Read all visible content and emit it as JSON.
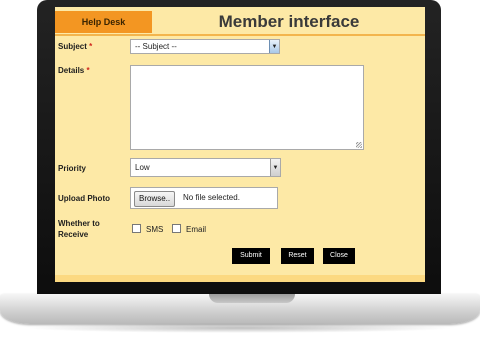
{
  "header": {
    "tab_label": "Help Desk",
    "title": "Member interface"
  },
  "form": {
    "subject": {
      "label": "Subject",
      "required_mark": "*",
      "value": "-- Subject --"
    },
    "details": {
      "label": "Details",
      "required_mark": "*"
    },
    "priority": {
      "label": "Priority",
      "value": "Low"
    },
    "upload": {
      "label": "Upload Photo",
      "button_label": "Browse..",
      "status": "No file selected."
    },
    "receive": {
      "label_line1": "Whether to",
      "label_line2": "Receive",
      "options": [
        "SMS",
        "Email"
      ]
    }
  },
  "buttons": {
    "submit": "Submit",
    "reset": "Reset",
    "close": "Close"
  },
  "colors": {
    "tab": "#f39622",
    "panel": "#fde9a6",
    "button": "#000000"
  }
}
